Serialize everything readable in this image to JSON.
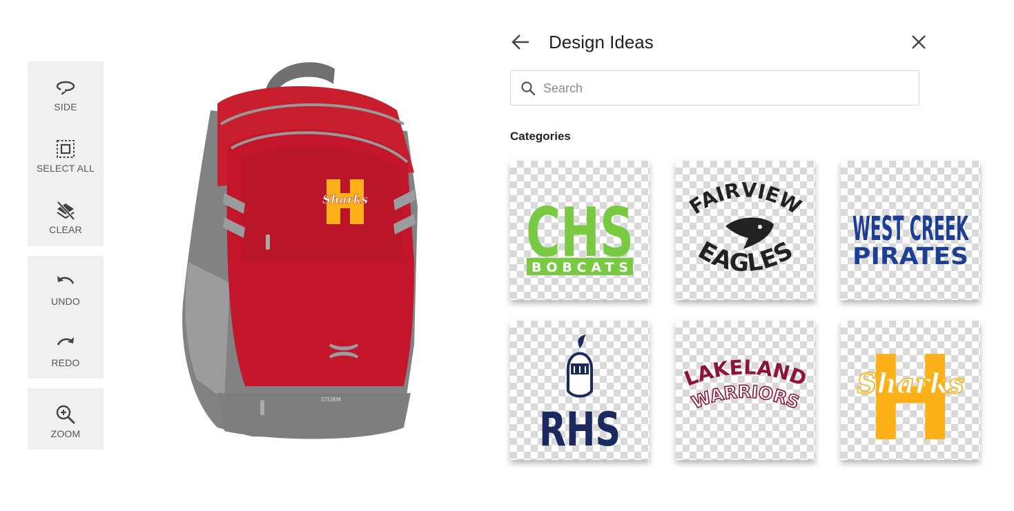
{
  "toolbar": {
    "side": "SIDE",
    "select_all": "SELECT ALL",
    "clear": "CLEAR",
    "undo": "UNDO",
    "redo": "REDO",
    "zoom": "ZOOM"
  },
  "product": {
    "logo_text": "Sharks",
    "logo_letter": "H",
    "brand_tag": "STORM"
  },
  "panel": {
    "title": "Design Ideas",
    "search_placeholder": "Search",
    "search_value": "",
    "categories_label": "Categories"
  },
  "designs": [
    {
      "line1": "CHS",
      "line2": "BOBCATS",
      "color": "#7ac943"
    },
    {
      "line1": "FAIRVIEW",
      "line2": "EAGLES",
      "color": "#222222"
    },
    {
      "line1": "WEST CREEK",
      "line2": "PIRATES",
      "color": "#1c3f94"
    },
    {
      "line1": "RHS",
      "line2": "",
      "color": "#1b2a5e"
    },
    {
      "line1": "LAKELAND",
      "line2": "WARRIORS",
      "color": "#8a1538"
    },
    {
      "line1": "H",
      "line2": "Sharks",
      "color": "#fbb117"
    }
  ],
  "colors": {
    "backpack_red": "#c81e2d",
    "backpack_gray": "#8d8f91",
    "toolbar_bg": "#f0f0f0"
  }
}
